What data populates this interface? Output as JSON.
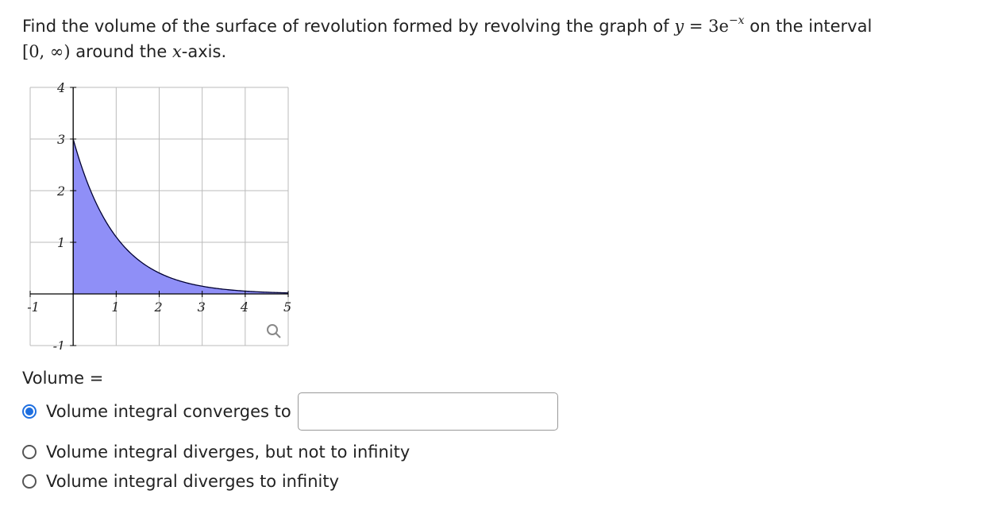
{
  "question": {
    "text_before": "Find the volume of the surface of revolution formed by revolving the graph of",
    "func_y": "y",
    "func_eq": " = 3e",
    "func_exp": "−x",
    "text_after": "on the interval",
    "interval": "[0, ∞)",
    "text_end": "around the",
    "axis_var": "x",
    "text_tail": "-axis."
  },
  "chart_data": {
    "type": "area",
    "function": "3e^(-x)",
    "x_domain": [
      0,
      5
    ],
    "xlim": [
      -1,
      5
    ],
    "ylim": [
      -1,
      4
    ],
    "x_ticks": [
      "-1",
      "1",
      "2",
      "3",
      "4",
      "5"
    ],
    "y_ticks": [
      "4",
      "3",
      "2",
      "1",
      "-1"
    ],
    "grid": true,
    "fill_color": "#8f8ff7",
    "line_color": "#000033"
  },
  "graph_zoom_icon": "magnifier-icon",
  "answer": {
    "label": "Volume =",
    "options": [
      {
        "label": "Volume integral converges to",
        "selected": true
      },
      {
        "label": "Volume integral diverges, but not to infinity",
        "selected": false
      },
      {
        "label": "Volume integral diverges to infinity",
        "selected": false
      }
    ],
    "input_value": ""
  },
  "colors": {
    "accent": "#1e6fe0"
  }
}
